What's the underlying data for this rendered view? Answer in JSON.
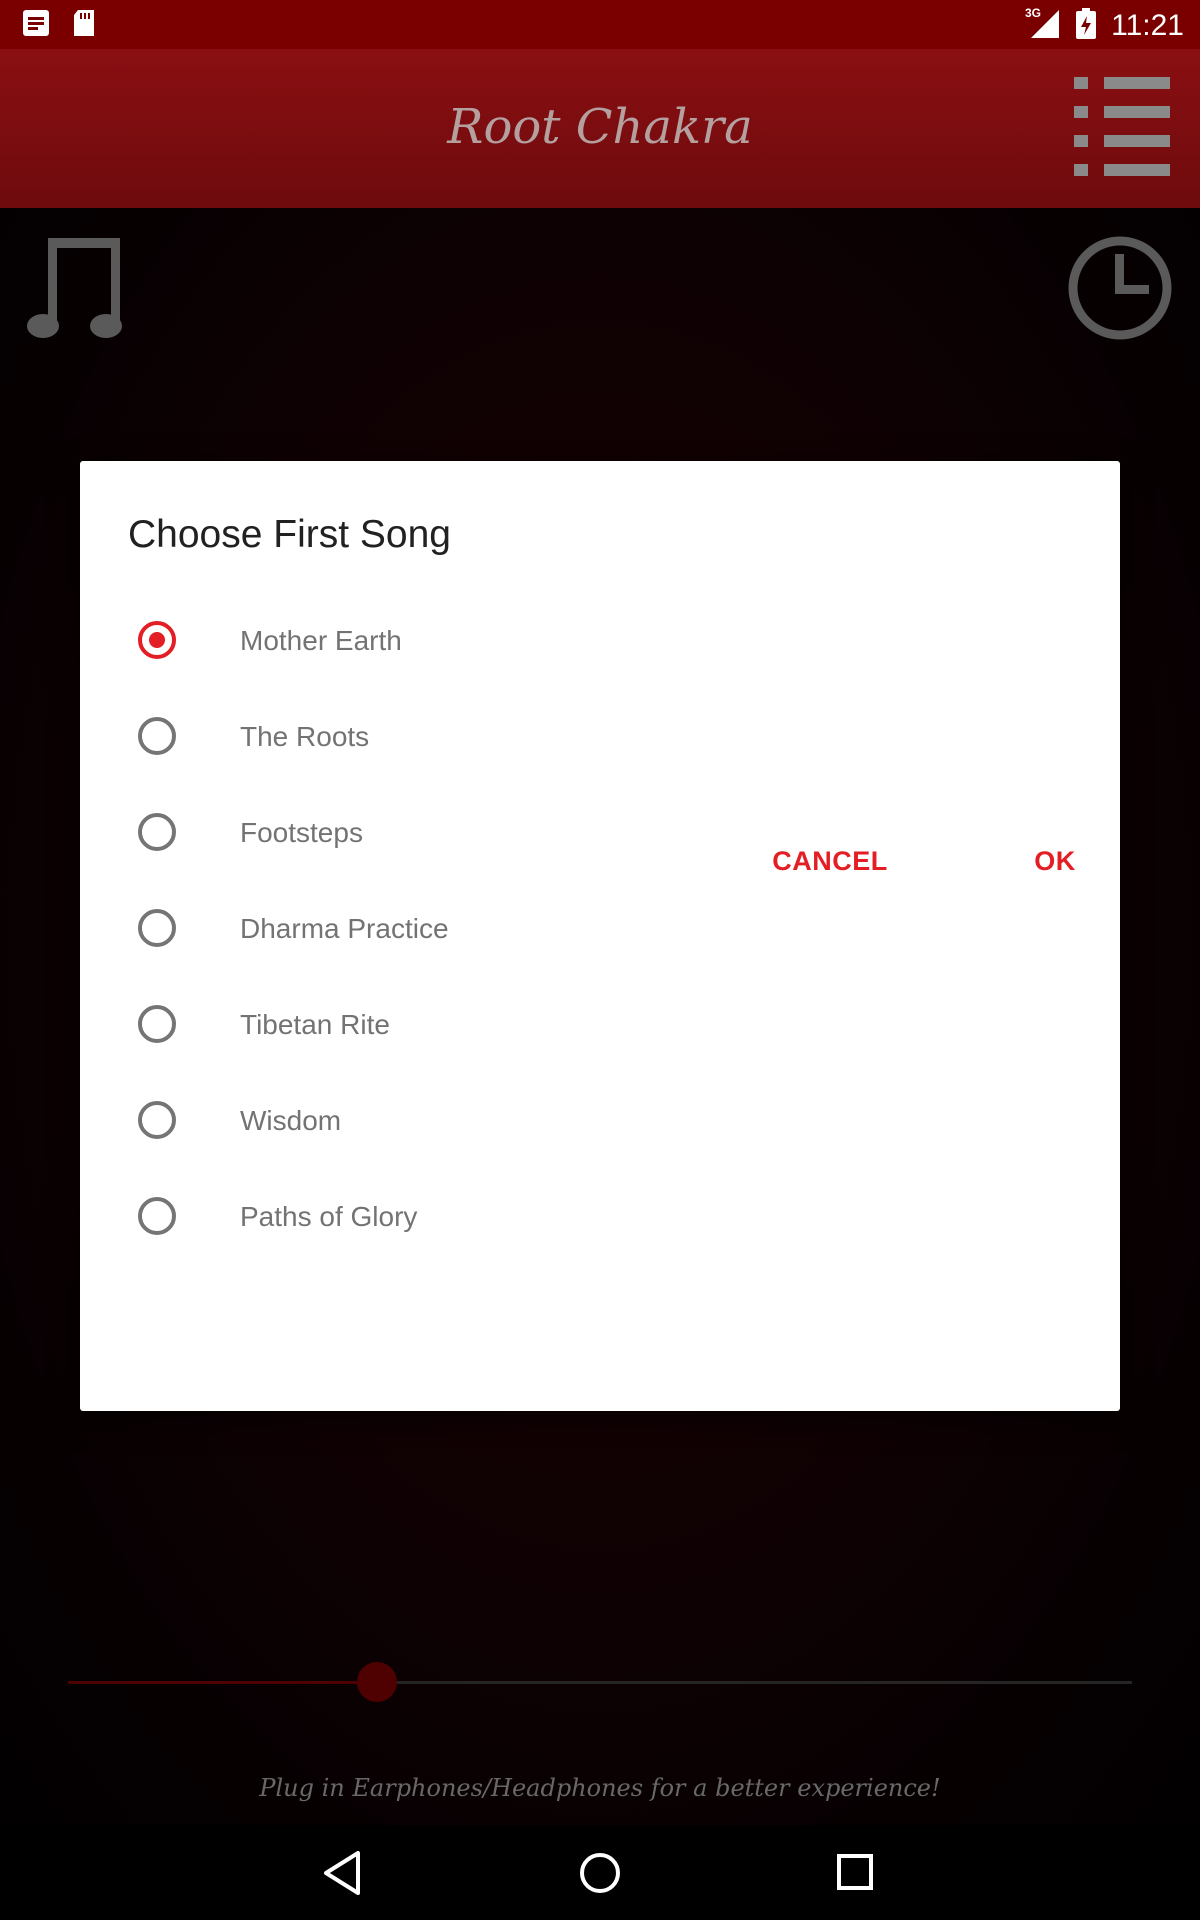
{
  "status_bar": {
    "time": "11:21",
    "network": "3G",
    "icons": [
      "notification-icon",
      "sd-card-icon",
      "signal-icon",
      "battery-icon"
    ]
  },
  "toolbar": {
    "title": "Root Chakra",
    "menu_icon": "list-icon"
  },
  "main": {
    "left_icon": "music-note-icon",
    "right_icon": "clock-icon",
    "hint": "Plug in Earphones/Headphones for a better experience!",
    "seek_progress": 0.29
  },
  "dialog": {
    "title": "Choose First Song",
    "options": [
      {
        "label": "Mother Earth",
        "selected": true
      },
      {
        "label": "The Roots",
        "selected": false
      },
      {
        "label": "Footsteps",
        "selected": false
      },
      {
        "label": "Dharma Practice",
        "selected": false
      },
      {
        "label": "Tibetan Rite",
        "selected": false
      },
      {
        "label": "Wisdom",
        "selected": false
      },
      {
        "label": "Paths of Glory",
        "selected": false
      }
    ],
    "cancel_label": "CANCEL",
    "ok_label": "OK"
  },
  "colors": {
    "accent": "#e31e24",
    "status_bar": "#7a0000",
    "toolbar": "#7d0d10"
  },
  "nav": [
    "back-icon",
    "home-icon",
    "recents-icon"
  ]
}
